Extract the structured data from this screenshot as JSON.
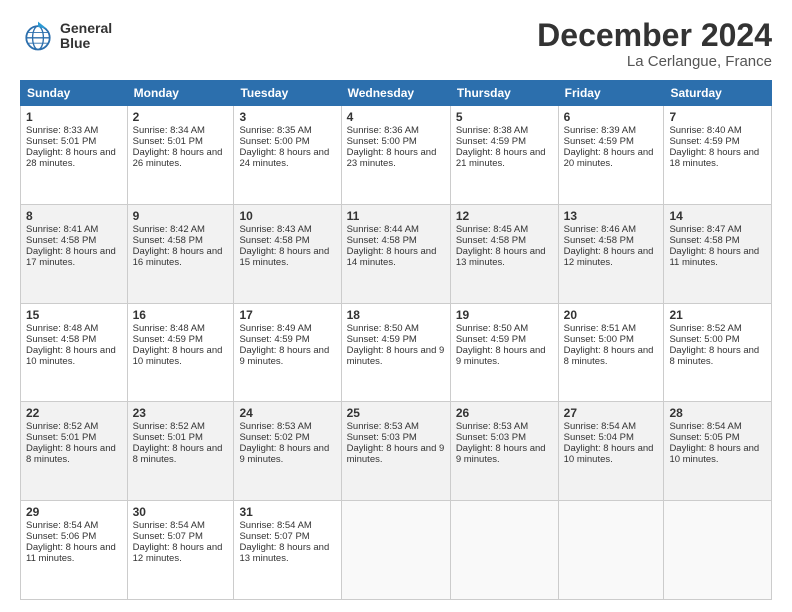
{
  "logo": {
    "line1": "General",
    "line2": "Blue"
  },
  "title": "December 2024",
  "subtitle": "La Cerlangue, France",
  "days_of_week": [
    "Sunday",
    "Monday",
    "Tuesday",
    "Wednesday",
    "Thursday",
    "Friday",
    "Saturday"
  ],
  "weeks": [
    [
      {
        "day": "1",
        "sunrise": "8:33 AM",
        "sunset": "5:01 PM",
        "daylight": "8 hours and 28 minutes."
      },
      {
        "day": "2",
        "sunrise": "8:34 AM",
        "sunset": "5:01 PM",
        "daylight": "8 hours and 26 minutes."
      },
      {
        "day": "3",
        "sunrise": "8:35 AM",
        "sunset": "5:00 PM",
        "daylight": "8 hours and 24 minutes."
      },
      {
        "day": "4",
        "sunrise": "8:36 AM",
        "sunset": "5:00 PM",
        "daylight": "8 hours and 23 minutes."
      },
      {
        "day": "5",
        "sunrise": "8:38 AM",
        "sunset": "4:59 PM",
        "daylight": "8 hours and 21 minutes."
      },
      {
        "day": "6",
        "sunrise": "8:39 AM",
        "sunset": "4:59 PM",
        "daylight": "8 hours and 20 minutes."
      },
      {
        "day": "7",
        "sunrise": "8:40 AM",
        "sunset": "4:59 PM",
        "daylight": "8 hours and 18 minutes."
      }
    ],
    [
      {
        "day": "8",
        "sunrise": "8:41 AM",
        "sunset": "4:58 PM",
        "daylight": "8 hours and 17 minutes."
      },
      {
        "day": "9",
        "sunrise": "8:42 AM",
        "sunset": "4:58 PM",
        "daylight": "8 hours and 16 minutes."
      },
      {
        "day": "10",
        "sunrise": "8:43 AM",
        "sunset": "4:58 PM",
        "daylight": "8 hours and 15 minutes."
      },
      {
        "day": "11",
        "sunrise": "8:44 AM",
        "sunset": "4:58 PM",
        "daylight": "8 hours and 14 minutes."
      },
      {
        "day": "12",
        "sunrise": "8:45 AM",
        "sunset": "4:58 PM",
        "daylight": "8 hours and 13 minutes."
      },
      {
        "day": "13",
        "sunrise": "8:46 AM",
        "sunset": "4:58 PM",
        "daylight": "8 hours and 12 minutes."
      },
      {
        "day": "14",
        "sunrise": "8:47 AM",
        "sunset": "4:58 PM",
        "daylight": "8 hours and 11 minutes."
      }
    ],
    [
      {
        "day": "15",
        "sunrise": "8:48 AM",
        "sunset": "4:58 PM",
        "daylight": "8 hours and 10 minutes."
      },
      {
        "day": "16",
        "sunrise": "8:48 AM",
        "sunset": "4:59 PM",
        "daylight": "8 hours and 10 minutes."
      },
      {
        "day": "17",
        "sunrise": "8:49 AM",
        "sunset": "4:59 PM",
        "daylight": "8 hours and 9 minutes."
      },
      {
        "day": "18",
        "sunrise": "8:50 AM",
        "sunset": "4:59 PM",
        "daylight": "8 hours and 9 minutes."
      },
      {
        "day": "19",
        "sunrise": "8:50 AM",
        "sunset": "4:59 PM",
        "daylight": "8 hours and 9 minutes."
      },
      {
        "day": "20",
        "sunrise": "8:51 AM",
        "sunset": "5:00 PM",
        "daylight": "8 hours and 8 minutes."
      },
      {
        "day": "21",
        "sunrise": "8:52 AM",
        "sunset": "5:00 PM",
        "daylight": "8 hours and 8 minutes."
      }
    ],
    [
      {
        "day": "22",
        "sunrise": "8:52 AM",
        "sunset": "5:01 PM",
        "daylight": "8 hours and 8 minutes."
      },
      {
        "day": "23",
        "sunrise": "8:52 AM",
        "sunset": "5:01 PM",
        "daylight": "8 hours and 8 minutes."
      },
      {
        "day": "24",
        "sunrise": "8:53 AM",
        "sunset": "5:02 PM",
        "daylight": "8 hours and 9 minutes."
      },
      {
        "day": "25",
        "sunrise": "8:53 AM",
        "sunset": "5:03 PM",
        "daylight": "8 hours and 9 minutes."
      },
      {
        "day": "26",
        "sunrise": "8:53 AM",
        "sunset": "5:03 PM",
        "daylight": "8 hours and 9 minutes."
      },
      {
        "day": "27",
        "sunrise": "8:54 AM",
        "sunset": "5:04 PM",
        "daylight": "8 hours and 10 minutes."
      },
      {
        "day": "28",
        "sunrise": "8:54 AM",
        "sunset": "5:05 PM",
        "daylight": "8 hours and 10 minutes."
      }
    ],
    [
      {
        "day": "29",
        "sunrise": "8:54 AM",
        "sunset": "5:06 PM",
        "daylight": "8 hours and 11 minutes."
      },
      {
        "day": "30",
        "sunrise": "8:54 AM",
        "sunset": "5:07 PM",
        "daylight": "8 hours and 12 minutes."
      },
      {
        "day": "31",
        "sunrise": "8:54 AM",
        "sunset": "5:07 PM",
        "daylight": "8 hours and 13 minutes."
      },
      null,
      null,
      null,
      null
    ]
  ],
  "labels": {
    "sunrise": "Sunrise:",
    "sunset": "Sunset:",
    "daylight": "Daylight:"
  }
}
